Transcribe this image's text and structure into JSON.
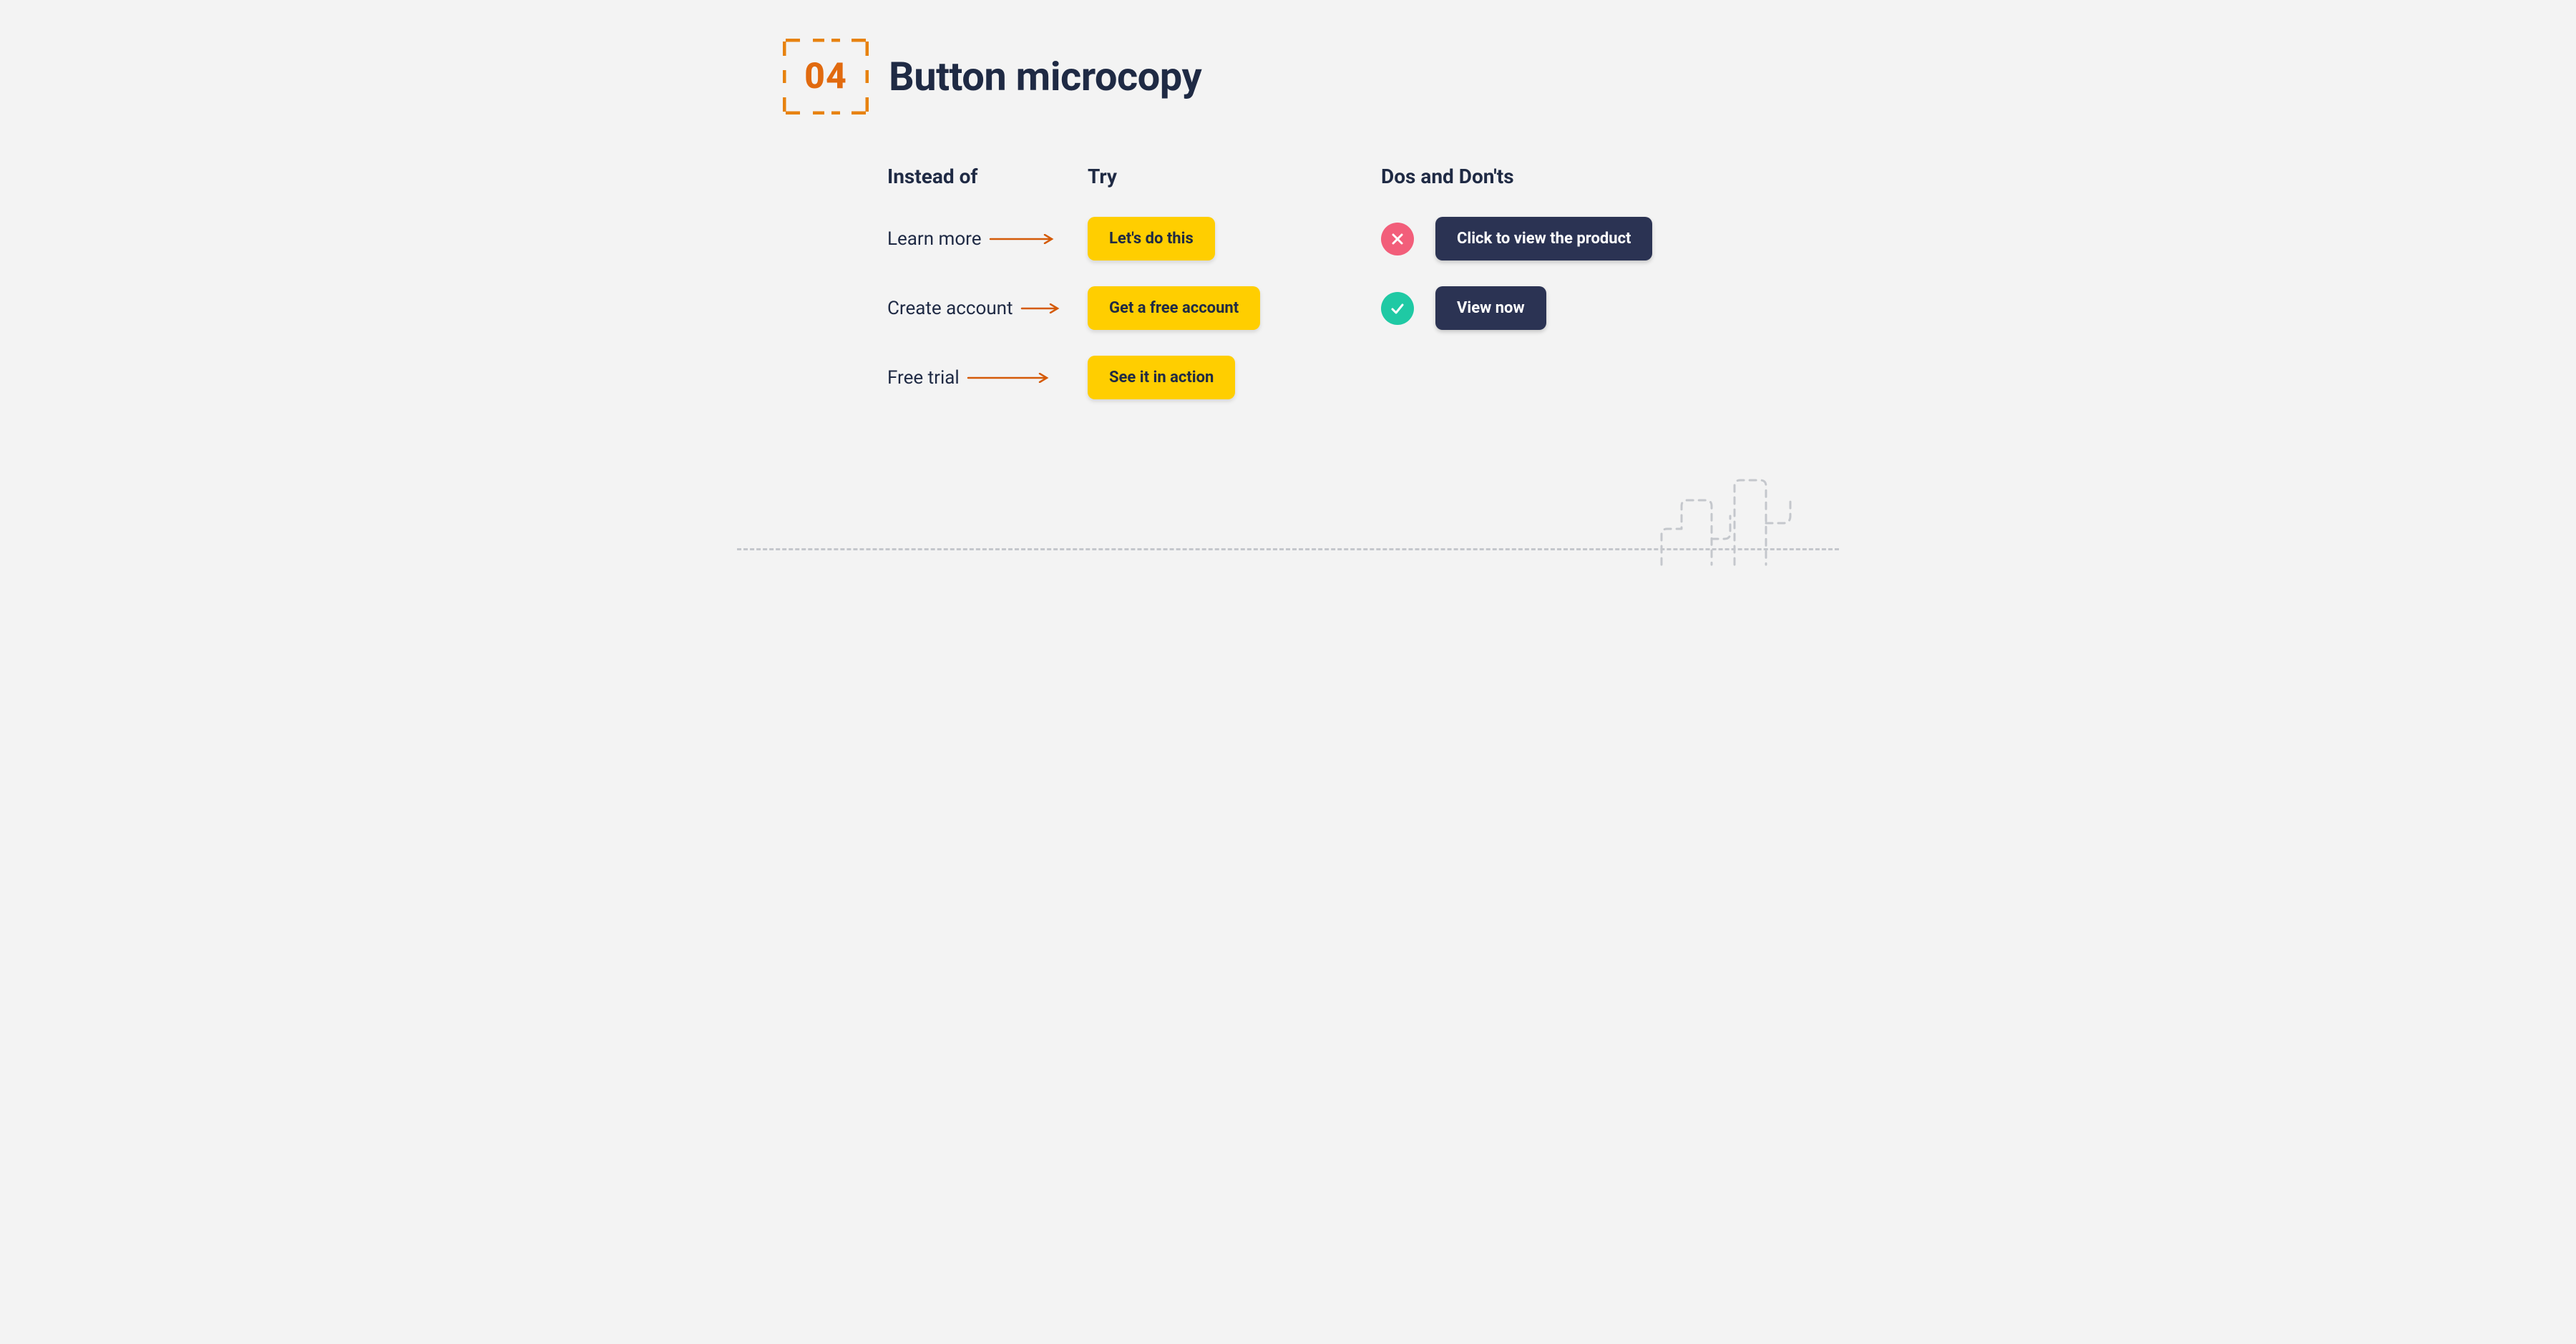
{
  "header": {
    "number": "04",
    "title": "Button microcopy"
  },
  "columns": {
    "instead_label": "Instead of",
    "try_label": "Try",
    "dos_label": "Dos and Don'ts"
  },
  "rows": [
    {
      "instead": "Learn more",
      "try": "Let's do this"
    },
    {
      "instead": "Create account",
      "try": "Get a free account"
    },
    {
      "instead": "Free trial",
      "try": "See it in action"
    }
  ],
  "dosdonts": {
    "dont_button": "Click to view the product",
    "do_button": "View now"
  },
  "colors": {
    "accent_orange": "#e16a0f",
    "button_yellow": "#ffce00",
    "button_dark": "#2b3353",
    "badge_bad": "#f25e7a",
    "badge_good": "#1fc9a4",
    "text_dark": "#1f2a44",
    "bg": "#f3f3f3"
  }
}
